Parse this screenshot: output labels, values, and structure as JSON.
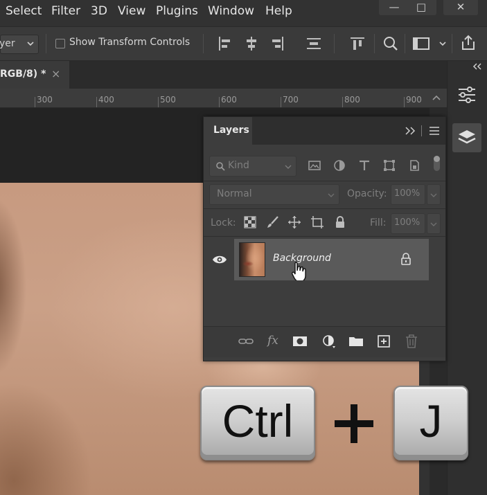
{
  "menu": {
    "items": [
      "Select",
      "Filter",
      "3D",
      "View",
      "Plugins",
      "Window",
      "Help"
    ],
    "window_buttons": [
      "—",
      "□",
      "✕"
    ]
  },
  "options_bar": {
    "layer_select_value": "yer",
    "show_transform_label": "Show Transform Controls",
    "show_transform_checked": false
  },
  "document_tab": {
    "title": "RGB/8) *",
    "close": "×"
  },
  "ruler": {
    "labels": [
      "300",
      "400",
      "500",
      "600",
      "700",
      "800",
      "900"
    ]
  },
  "layers_panel": {
    "title": "Layers",
    "kind_filter": "Kind",
    "blend_mode": "Normal",
    "opacity_label": "Opacity:",
    "opacity_value": "100%",
    "lock_label": "Lock:",
    "fill_label": "Fill:",
    "fill_value": "100%",
    "layers": [
      {
        "name": "Background",
        "visible": true,
        "locked": true
      }
    ]
  },
  "shortcut_overlay": {
    "key1": "Ctrl",
    "plus": "+",
    "key2": "J"
  },
  "colors": {
    "ui_dark": "#323232",
    "panel": "#3d3d3d",
    "selected_layer": "#5a5a5a",
    "skin": "#c79a80"
  }
}
